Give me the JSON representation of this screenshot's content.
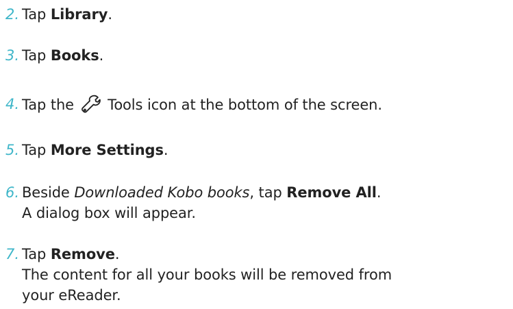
{
  "steps": [
    {
      "number": "2.",
      "text_before": "Tap ",
      "bold": "Library",
      "text_after": "."
    },
    {
      "number": "3.",
      "text_before": "Tap ",
      "bold": "Books",
      "text_after": "."
    },
    {
      "number": "4.",
      "text_before": "Tap the ",
      "icon": "wrench-icon",
      "text_after": " Tools icon at the bottom of the screen."
    },
    {
      "number": "5.",
      "text_before": "Tap ",
      "bold": "More Settings",
      "text_after": "."
    },
    {
      "number": "6.",
      "text_before": "Beside ",
      "italic": "Downloaded Kobo books",
      "text_middle": ", tap ",
      "bold": "Remove All",
      "text_after": ".",
      "line2": "A dialog box will appear."
    },
    {
      "number": "7.",
      "text_before": "Tap ",
      "bold": "Remove",
      "text_after": ".",
      "line2": "The content for all your books will be removed from",
      "line3": "your eReader."
    }
  ],
  "colors": {
    "number": "#3fb6c9",
    "text": "#222222"
  }
}
